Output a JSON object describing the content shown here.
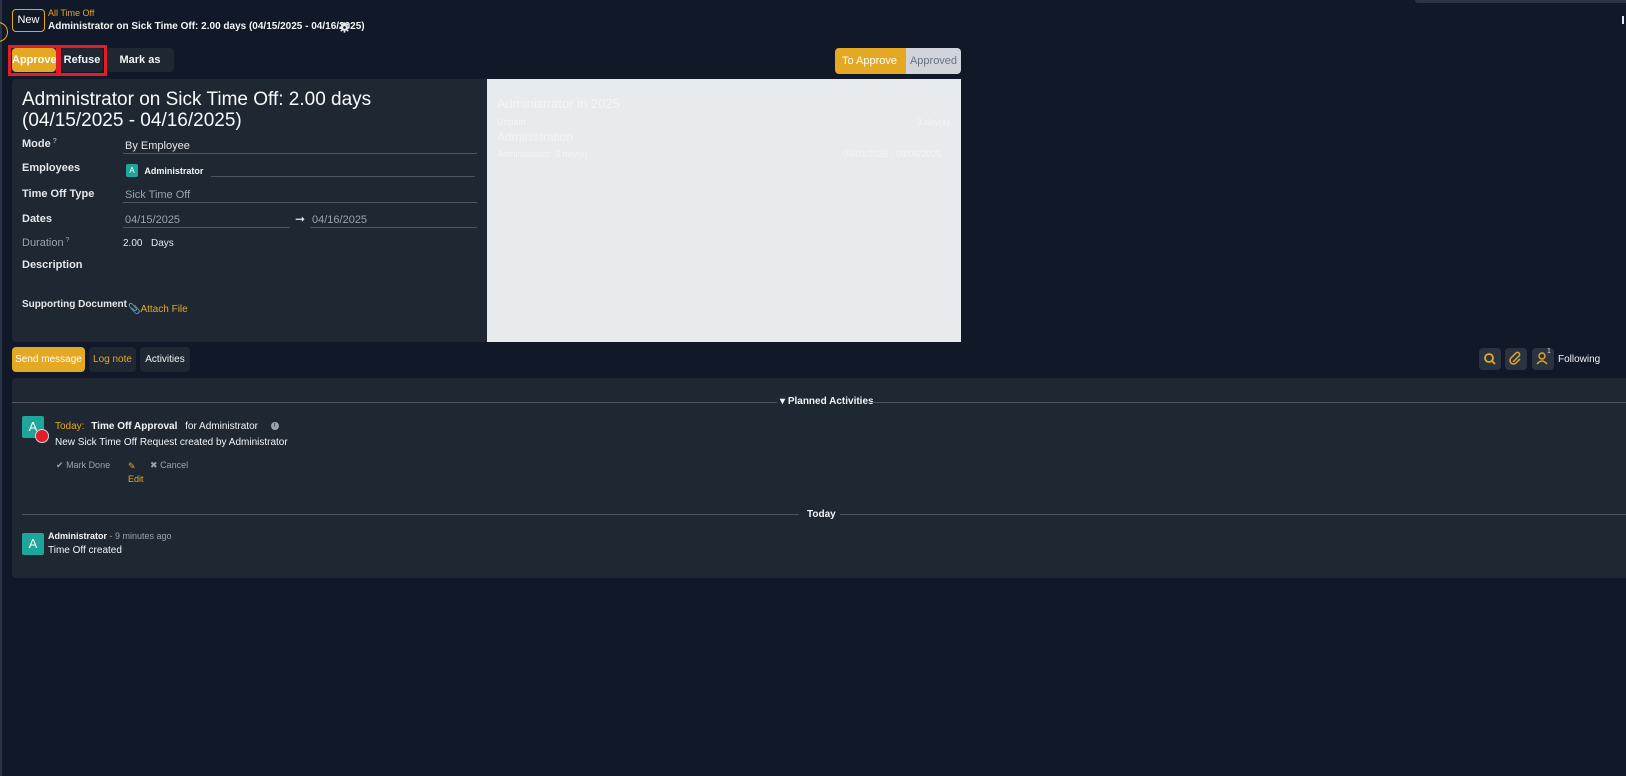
{
  "header": {
    "new_label": "New",
    "breadcrumb_parent": "All Time Off",
    "record_title": "Administrator on Sick Time Off: 2.00 days (04/15/2025 - 04/16/2025)"
  },
  "statusbar": {
    "approve_label": "Approve",
    "refuse_label": "Refuse",
    "draft_label": "Mark as Draft",
    "stages": [
      {
        "label": "To Approve",
        "active": true
      },
      {
        "label": "Approved",
        "active": false
      }
    ]
  },
  "form": {
    "title_line1": "Administrator on Sick Time Off: 2.00 days",
    "title_line2": "(04/15/2025 - 04/16/2025)",
    "mode_label": "Mode",
    "mode_value": "By Employee",
    "employees_label": "Employees",
    "employee_avatar": "A",
    "employee_name": "Administrator",
    "type_label": "Time Off Type",
    "type_value": "Sick Time Off",
    "dates_label": "Dates",
    "date_from": "04/15/2025",
    "date_arrow": "➞",
    "date_to": "04/16/2025",
    "duration_label": "Duration",
    "duration_value": "2.00",
    "duration_unit": "Days",
    "description_label": "Description",
    "document_label": "Supporting Document",
    "attach_label": "Attach File"
  },
  "side_panel": {
    "heading": "Administrator in 2025",
    "unpaid_label": "Unpaid",
    "unpaid_value": "3 day(s)",
    "dept_heading": "Administration",
    "row_label": "Administrator: 3 day(s)",
    "row_dates": "04/04/2025 - 04/06/2025"
  },
  "chatter": {
    "send_label": "Send message",
    "log_label": "Log note",
    "activities_label": "Activities",
    "follower_count": "1",
    "following_label": "Following",
    "planned_label": "Planned Activities",
    "activity": {
      "avatar": "A",
      "when": "Today:",
      "name": "Time Off Approval",
      "for_text": "for Administrator",
      "summary": "New Sick Time Off Request created by Administrator",
      "mark_done": "Mark Done",
      "edit": "Edit",
      "cancel": "Cancel"
    },
    "today_label": "Today",
    "message": {
      "avatar": "A",
      "author": "Administrator",
      "time": "- 9 minutes ago",
      "body": "Time Off created"
    }
  },
  "colors": {
    "accent": "#e5a823",
    "background": "#111827",
    "panel": "#1f2733",
    "highlight": "#e11d2a",
    "avatar": "#1ea69a"
  }
}
